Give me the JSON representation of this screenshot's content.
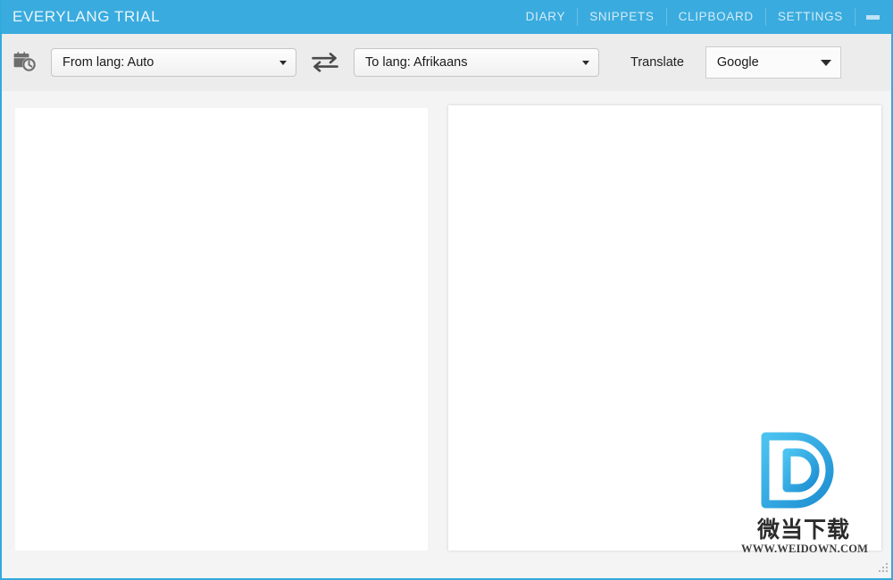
{
  "window": {
    "title": "EVERYLANG TRIAL",
    "accent_color": "#3aabde",
    "border_color": "#33aadd",
    "background_color": "#f4f4f4",
    "toolbar_color": "#ececec"
  },
  "titlebar": {
    "nav_items": [
      {
        "label": "DIARY",
        "name": "nav-diary"
      },
      {
        "label": "SNIPPETS",
        "name": "nav-snippets"
      },
      {
        "label": "CLIPBOARD",
        "name": "nav-clipboard"
      },
      {
        "label": "SETTINGS",
        "name": "nav-settings"
      }
    ],
    "minimize_icon": "minimize-icon"
  },
  "toolbar": {
    "history_icon": "calendar-clock-icon",
    "from_lang": {
      "label": "From lang: Auto",
      "value": "Auto",
      "icon": "chevron-down-icon"
    },
    "swap_icon": "swap-arrows-icon",
    "to_lang": {
      "label": "To lang: Afrikaans",
      "value": "Afrikaans",
      "icon": "chevron-down-icon"
    },
    "translate_label": "Translate",
    "engine": {
      "value": "Google",
      "icon": "chevron-down-icon"
    }
  },
  "panels": {
    "source": {
      "text": "",
      "placeholder": ""
    },
    "target": {
      "text": "",
      "placeholder": ""
    }
  },
  "watermark": {
    "logo_letter": "D",
    "cn_text": "微当下载",
    "url_text": "WWW.WEIDOWN.COM",
    "color_light": "#3fb6ea",
    "color_dark": "#1f8fd4"
  },
  "statusbar": {
    "resize_grip": "resize-grip-icon"
  }
}
